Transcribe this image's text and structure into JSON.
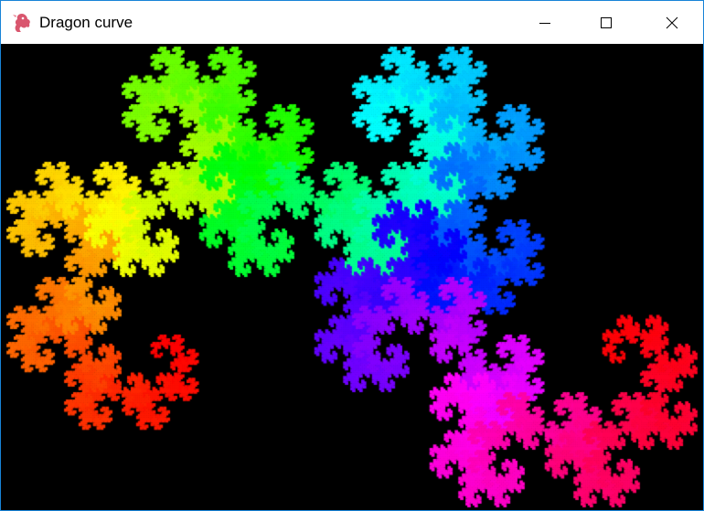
{
  "window": {
    "title": "Dragon curve",
    "app_icon": "dragon-icon",
    "accent_border_color": "#1883d7",
    "controls": {
      "minimize": "minimize-icon",
      "maximize": "maximize-icon",
      "close": "close-icon"
    }
  },
  "canvas": {
    "background_color": "#000000",
    "content": "dragon-curve-fractal",
    "coloring": "rainbow-hue"
  }
}
